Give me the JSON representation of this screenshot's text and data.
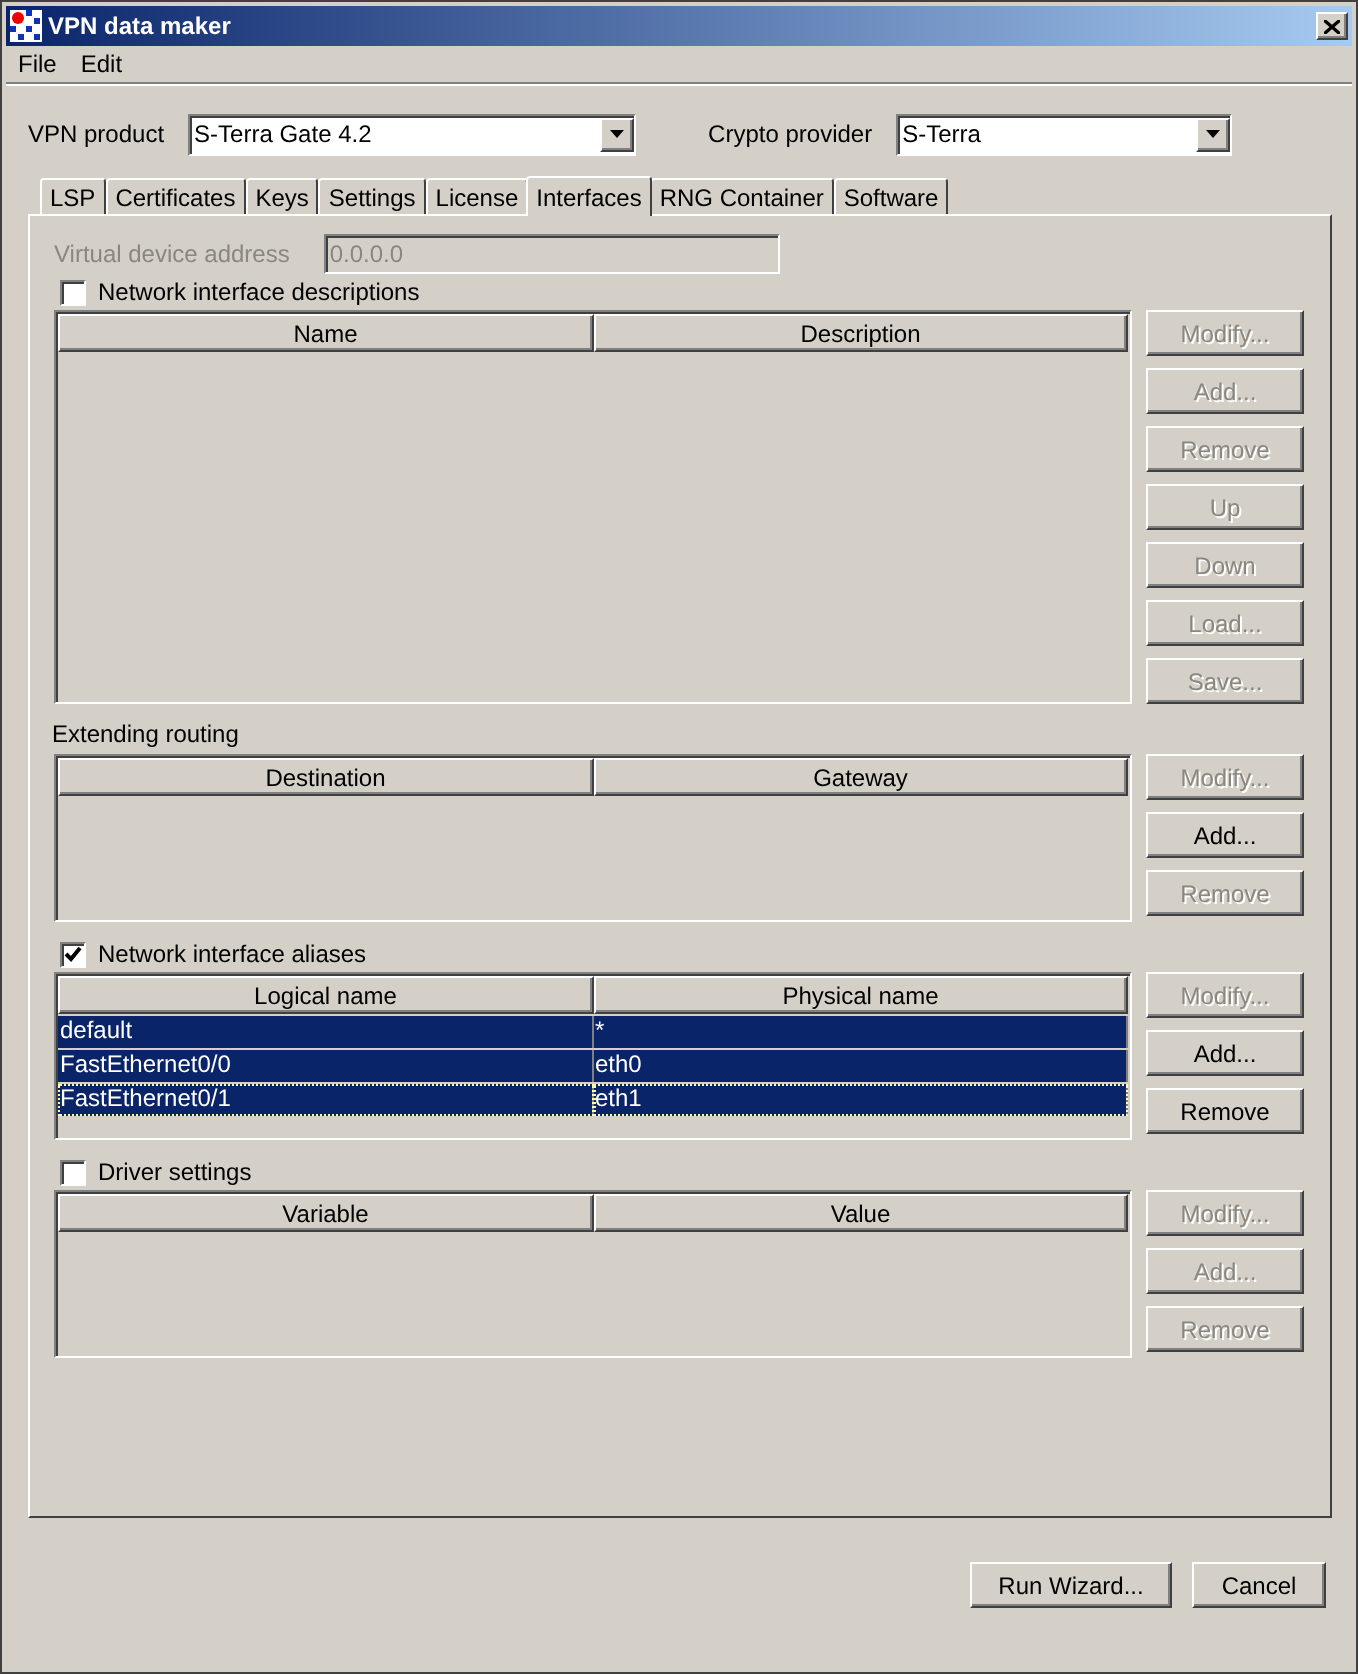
{
  "window": {
    "title": "VPN data maker"
  },
  "menu": [
    "File",
    "Edit"
  ],
  "selectors": [
    {
      "label": "VPN product",
      "value": "S-Terra Gate 4.2"
    },
    {
      "label": "Crypto provider",
      "value": "S-Terra"
    }
  ],
  "tabs": [
    {
      "label": "LSP",
      "selected": false
    },
    {
      "label": "Certificates",
      "selected": false
    },
    {
      "label": "Keys",
      "selected": false
    },
    {
      "label": "Settings",
      "selected": false
    },
    {
      "label": "License",
      "selected": false
    },
    {
      "label": "Interfaces",
      "selected": true
    },
    {
      "label": "RNG Container",
      "selected": false
    },
    {
      "label": "Software",
      "selected": false
    }
  ],
  "virtual_device_address": {
    "label": "Virtual device address",
    "value": "0.0.0.0",
    "disabled": true
  },
  "sections": [
    {
      "kind": "checkbox",
      "title": "Network interface descriptions",
      "checked": false,
      "columns": [
        "Name",
        "Description"
      ],
      "buttons": [
        {
          "label": "Modify...",
          "disabled": true
        },
        {
          "label": "Add...",
          "disabled": true
        },
        {
          "label": "Remove",
          "disabled": true
        },
        {
          "label": "Up",
          "disabled": true
        },
        {
          "label": "Down",
          "disabled": true
        },
        {
          "label": "Load...",
          "disabled": true
        },
        {
          "label": "Save...",
          "disabled": true
        }
      ]
    },
    {
      "kind": "label",
      "title": "Extending routing",
      "columns": [
        "Destination",
        "Gateway"
      ],
      "buttons": [
        {
          "label": "Modify...",
          "disabled": true
        },
        {
          "label": "Add...",
          "disabled": false
        },
        {
          "label": "Remove",
          "disabled": true
        }
      ]
    },
    {
      "kind": "checkbox",
      "title": "Network interface aliases",
      "checked": true,
      "columns": [
        "Logical name",
        "Physical name"
      ],
      "rows": [
        {
          "cells": [
            "default",
            "*"
          ],
          "selected": true,
          "focused": false
        },
        {
          "cells": [
            "FastEthernet0/0",
            "eth0"
          ],
          "selected": true,
          "focused": false
        },
        {
          "cells": [
            "FastEthernet0/1",
            "eth1"
          ],
          "selected": true,
          "focused": true
        }
      ],
      "buttons": [
        {
          "label": "Modify...",
          "disabled": true
        },
        {
          "label": "Add...",
          "disabled": false
        },
        {
          "label": "Remove",
          "disabled": false
        }
      ]
    },
    {
      "kind": "checkbox",
      "title": "Driver settings",
      "checked": false,
      "columns": [
        "Variable",
        "Value"
      ],
      "buttons": [
        {
          "label": "Modify...",
          "disabled": true
        },
        {
          "label": "Add...",
          "disabled": true
        },
        {
          "label": "Remove",
          "disabled": true
        }
      ]
    }
  ],
  "footer_buttons": [
    "Run Wizard...",
    "Cancel"
  ]
}
